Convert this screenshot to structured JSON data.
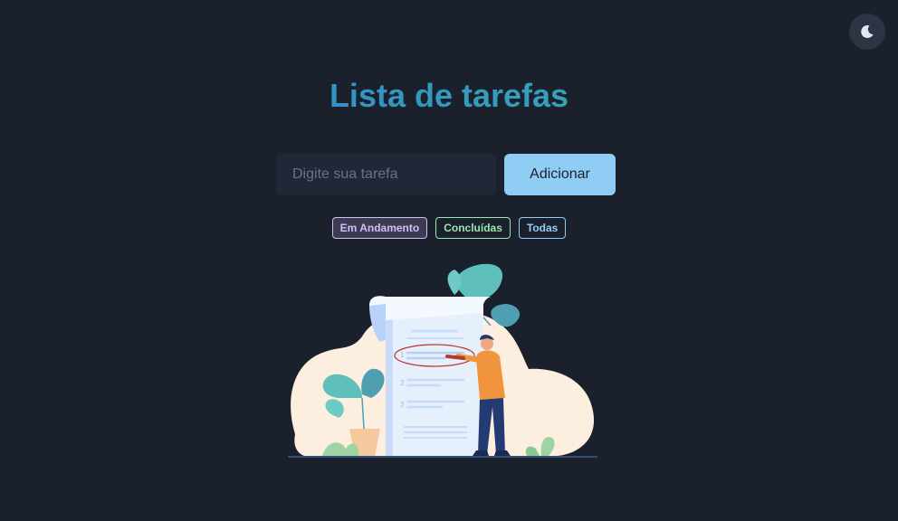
{
  "header": {
    "title": "Lista de tarefas",
    "theme_toggle_icon": "moon-icon"
  },
  "form": {
    "input_placeholder": "Digite sua tarefa",
    "input_value": "",
    "add_label": "Adicionar"
  },
  "filters": [
    {
      "label": "Em Andamento",
      "color": "#d6bcfa",
      "active": true
    },
    {
      "label": "Concluídas",
      "color": "#9ae6b4",
      "active": false
    },
    {
      "label": "Todas",
      "color": "#90cdf4",
      "active": false
    }
  ],
  "illustration": {
    "icon": "todo-list-illustration",
    "list_numbers": [
      "1",
      "2",
      "3"
    ]
  },
  "colors": {
    "background": "#1a202c",
    "accent": "#90cdf4",
    "title_gradient_start": "#3182ce",
    "title_gradient_end": "#38b2ac"
  }
}
